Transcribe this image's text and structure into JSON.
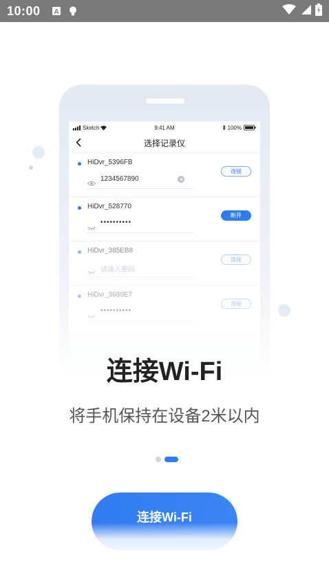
{
  "status_bar": {
    "time": "10:00",
    "left_icons": [
      "text-a-icon",
      "lightbulb-icon"
    ],
    "right_icons": [
      "wifi-icon",
      "cell-signal-icon",
      "battery-icon"
    ]
  },
  "illustration": {
    "ios_status": {
      "carrier": "Sketch",
      "time": "9:41 AM",
      "battery": "100%"
    },
    "nav_title": "选择记录仪",
    "devices": [
      {
        "name": "HiDvr_5396FB",
        "password": "1234567890",
        "button": "连接"
      },
      {
        "name": "HiDvr_528770",
        "password": "••••••••••",
        "button": "断开"
      },
      {
        "name": "HiDvr_385EB8",
        "password_placeholder": "请输入密码",
        "button": "连接"
      },
      {
        "name": "HiDvr_3680E7",
        "password": "••••••••••",
        "button": "连接"
      }
    ],
    "accent_color": "#2f7bf0"
  },
  "title": "连接Wi-Fi",
  "subtitle": "将手机保持在设备2米以内",
  "pager": {
    "pages": 2,
    "current": 2
  },
  "cta": {
    "label": "连接Wi-Fi"
  }
}
